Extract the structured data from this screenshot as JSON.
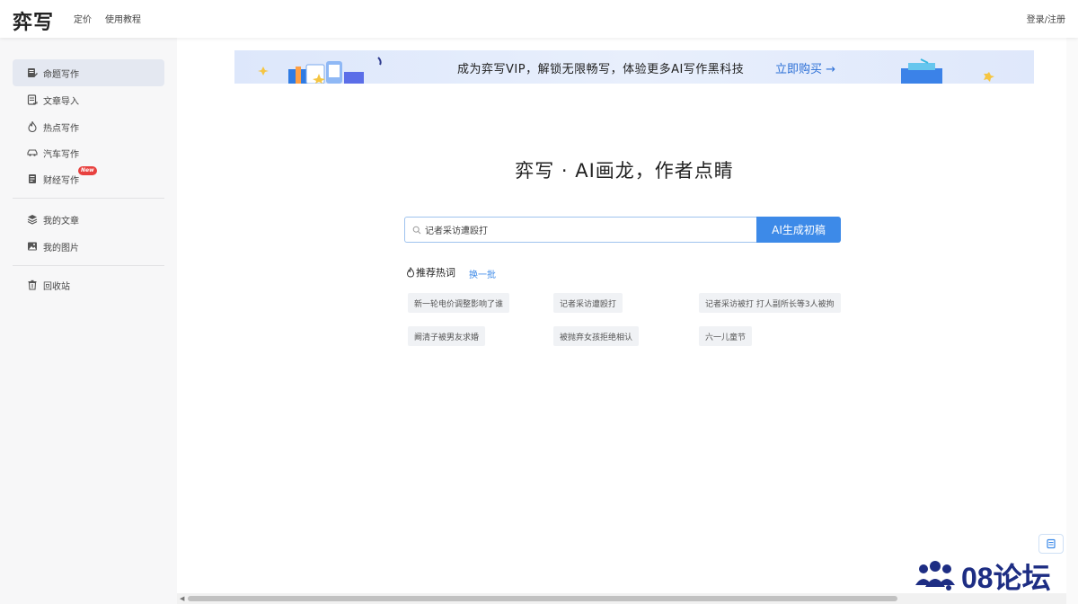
{
  "header": {
    "logo": "弈写",
    "nav": [
      "定价",
      "使用教程"
    ],
    "login": "登录/注册"
  },
  "sidebar": {
    "items": [
      {
        "label": "命题写作",
        "icon": "edit-doc-icon",
        "active": true
      },
      {
        "label": "文章导入",
        "icon": "import-doc-icon"
      },
      {
        "label": "热点写作",
        "icon": "flame-icon"
      },
      {
        "label": "汽车写作",
        "icon": "car-icon"
      },
      {
        "label": "财经写作",
        "icon": "finance-doc-icon",
        "badge": "New"
      },
      {
        "label": "我的文章",
        "icon": "layers-icon"
      },
      {
        "label": "我的图片",
        "icon": "image-icon"
      },
      {
        "label": "回收站",
        "icon": "trash-icon"
      }
    ]
  },
  "banner": {
    "text": "成为弈写VIP，解锁无限畅写，体验更多AI写作黑科技",
    "cta": "立即购买 →"
  },
  "hero": {
    "title": "弈写 · AI画龙，作者点睛"
  },
  "search": {
    "value": "记者采访遭殴打",
    "button": "AI生成初稿"
  },
  "hot": {
    "heading": "推荐热词",
    "refresh": "换一批",
    "tags": [
      "新一轮电价调整影响了谁",
      "记者采访遭殴打",
      "记者采访被打 打人副所长等3人被拘",
      "阚清子被男友求婚",
      "被抛弃女孩拒绝相认",
      "六一儿童节"
    ]
  },
  "watermark": {
    "text": "08论坛"
  },
  "colors": {
    "accent": "#3d8ae8",
    "banner_cta": "#2b6fd6",
    "sidebar_bg": "#f7f7f8",
    "active_bg": "#e4e8f1",
    "badge": "#e8413f"
  }
}
